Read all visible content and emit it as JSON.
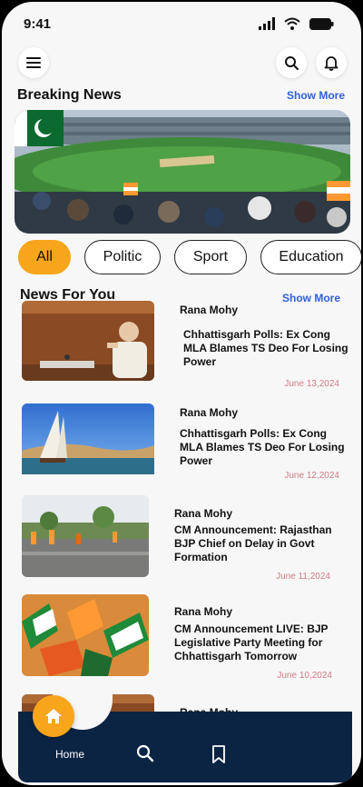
{
  "status": {
    "time": "9:41"
  },
  "header": {
    "menu_icon": "menu-icon",
    "search_icon": "search-icon",
    "bell_icon": "bell-icon"
  },
  "breaking": {
    "title": "Breaking News",
    "show_more": "Show More"
  },
  "categories": [
    {
      "label": "All",
      "active": true
    },
    {
      "label": "Politic",
      "active": false
    },
    {
      "label": "Sport",
      "active": false
    },
    {
      "label": "Education",
      "active": false
    }
  ],
  "for_you": {
    "title": "News For You",
    "show_more": "Show More"
  },
  "news": [
    {
      "author": "Rana Mohy",
      "title": "Chhattisgarh Polls: Ex Cong MLA Blames TS Deo For Losing Power",
      "date": "June 13,2024"
    },
    {
      "author": "Rana Mohy",
      "title": "Chhattisgarh Polls: Ex Cong MLA Blames TS Deo For Losing Power",
      "date": "June 12,2024"
    },
    {
      "author": "Rana Mohy",
      "title": "CM Announcement: Rajasthan BJP Chief on Delay in Govt Formation",
      "date": "June 11,2024"
    },
    {
      "author": "Rana  Mohy",
      "title": "CM Announcement LIVE: BJP Legislative Party Meeting for Chhattisgarh Tomorrow",
      "date": "June 10,2024"
    },
    {
      "author": "Rana Mohy"
    }
  ],
  "nav": {
    "home_label": "Home",
    "home_icon": "home-icon",
    "search_icon": "search-icon",
    "bookmark_icon": "bookmark-icon"
  },
  "colors": {
    "accent": "#f7a51a",
    "link": "#2f5fd6",
    "nav_bg": "#0c2444",
    "date": "#d07b84"
  }
}
